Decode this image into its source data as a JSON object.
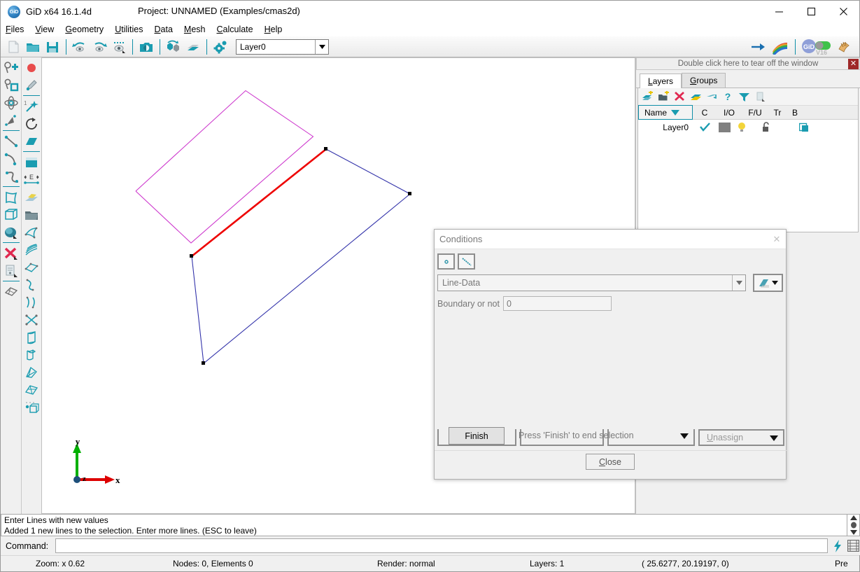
{
  "window": {
    "app_title": "GiD x64 16.1.4d",
    "project": "Project: UNNAMED (Examples/cmas2d)",
    "logo_text": "GiD",
    "minimize": "—",
    "maximize": "□",
    "close": "✕"
  },
  "menu": [
    {
      "label": "Files",
      "mnemonic": "F"
    },
    {
      "label": "View",
      "mnemonic": "V"
    },
    {
      "label": "Geometry",
      "mnemonic": "G"
    },
    {
      "label": "Utilities",
      "mnemonic": "U"
    },
    {
      "label": "Data",
      "mnemonic": "D"
    },
    {
      "label": "Mesh",
      "mnemonic": "M"
    },
    {
      "label": "Calculate",
      "mnemonic": "C"
    },
    {
      "label": "Help",
      "mnemonic": "H"
    }
  ],
  "toolbar": {
    "icons": [
      "new-file-icon",
      "open-folder-icon",
      "save-icon",
      "undo-view-icon",
      "redo-view-icon",
      "zoom-eye-icon",
      "snapshot-camera-icon",
      "rotate-cube-icon",
      "layers-stack-icon",
      "preferences-gear-icon"
    ],
    "layer_combo_value": "Layer0",
    "right_icons": [
      "import-arrow-icon",
      "color-palette-icon",
      "gid-toggle-icon",
      "gid-version-icon",
      "postprocess-icon"
    ],
    "gid_version_label": "V16",
    "gid_badge_label": "GiD"
  },
  "left_toolbar": {
    "col_a": [
      "create-point-icon",
      "point-in-object-icon",
      "intersection-point-icon",
      "point-arrow-icon",
      "create-line-icon",
      "create-arc-icon",
      "create-nurbs-line-icon",
      "create-surface-icon",
      "create-volume-icon",
      "create-object-icon",
      "delete-icon",
      "layer-properties-icon",
      "surface-mesh-icon"
    ],
    "col_b": [
      "red-dot-icon",
      "pencil-icon",
      "magic-wand-icon",
      "rotate-refresh-icon",
      "parallelogram-icon",
      "rectangle-icon",
      "edge-dimension-icon",
      "nurbs-surface-icon",
      "open-layer-folder-icon",
      "coons-surface-icon",
      "ruled-surface-icon",
      "contour-surface-icon",
      "trimmed-surface-icon",
      "nurbs-curve-icon",
      "curve-pair-icon",
      "intersect-lines-icon",
      "prism-volume-icon",
      "sweep-volume-icon",
      "revolve-volume-icon",
      "loft-volume-icon",
      "object-cube-icon"
    ],
    "edge_label": "E",
    "magic_label": "1"
  },
  "canvas": {
    "axis": {
      "x": "x",
      "y": "y",
      "z": "z"
    },
    "geometry": {
      "outer_color": "#3333aa",
      "selected_color": "#ee0000",
      "inner_color": "#cc33cc",
      "point_color": "#000000"
    }
  },
  "right_panel": {
    "tearoff_text": "Double click here to tear off the window",
    "tearoff_close": "✕",
    "tabs": [
      {
        "label": "Layers",
        "mnemonic": "L",
        "active": true
      },
      {
        "label": "Groups",
        "mnemonic": "G",
        "active": false
      }
    ],
    "toolbar_icons": [
      "new-layer-icon",
      "new-group-layer-icon",
      "delete-layer-icon",
      "layer-send-to-icon",
      "layer-move-icon",
      "layer-help-icon",
      "layer-filter-icon",
      "layer-info-icon"
    ],
    "columns": [
      {
        "key": "name",
        "label": "Name"
      },
      {
        "key": "c",
        "label": "C"
      },
      {
        "key": "io",
        "label": "I/O"
      },
      {
        "key": "fu",
        "label": "F/U"
      },
      {
        "key": "tr",
        "label": "Tr"
      },
      {
        "key": "b",
        "label": "B"
      }
    ],
    "rows": [
      {
        "name": "Layer0",
        "c": "check",
        "color": "#808080",
        "io": "bulb-on",
        "fu": "unlocked",
        "tr": "",
        "b": "box-selected"
      }
    ]
  },
  "dialog": {
    "title": "Conditions",
    "close_glyph": "✕",
    "entity_buttons": [
      {
        "name": "point-condition-icon",
        "selected": false
      },
      {
        "name": "line-condition-icon",
        "selected": true
      }
    ],
    "condition_combo": "Line-Data",
    "hatch_button": "material-hatch-icon",
    "field_label": "Boundary or not",
    "field_value": "0",
    "finish_button": "Finish",
    "hint_text": "Press 'Finish' to end selection",
    "unassign_button": "Unassign",
    "unassign_mnemonic": "U",
    "close_button": "Close",
    "close_mnemonic": "C"
  },
  "messages": {
    "line1": "Enter Lines with new values",
    "line2": "Added 1 new  lines to the selection. Enter more lines. (ESC to leave)"
  },
  "command": {
    "label": "Command:",
    "value": "",
    "icons": [
      "lightning-icon",
      "grid-table-icon"
    ]
  },
  "status": {
    "zoom": "Zoom: x 0.62",
    "mesh": "Nodes: 0, Elements 0",
    "render": "Render: normal",
    "layers": "Layers: 1",
    "coords": "(  25.6277,  20.19197,  0)",
    "mode": "Pre"
  },
  "colors": {
    "accent": "#0f8fa8",
    "teal": "#1a9cb0",
    "panel_bg": "#f0f0f0",
    "selected_red": "#ee0000",
    "magenta": "#cc33cc",
    "blue": "#3333aa"
  }
}
